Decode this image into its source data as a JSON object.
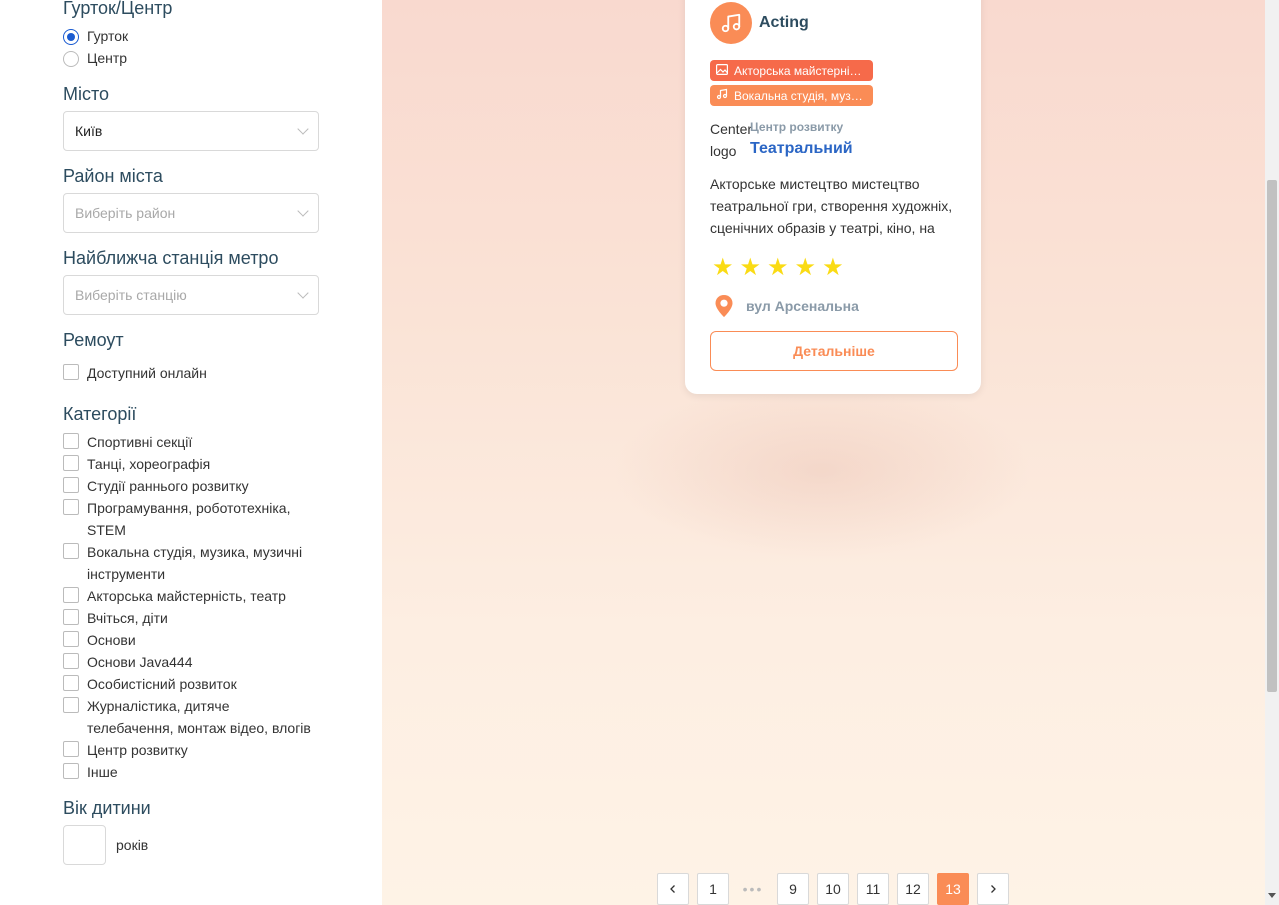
{
  "filters": {
    "type_title": "Гурток/Центр",
    "type_options": [
      {
        "label": "Гурток",
        "checked": true
      },
      {
        "label": "Центр",
        "checked": false
      }
    ],
    "city_title": "Місто",
    "city_value": "Київ",
    "district_title": "Район міста",
    "district_placeholder": "Виберіть район",
    "metro_title": "Найближча станція метро",
    "metro_placeholder": "Виберіть станцію",
    "remote_title": "Ремоут",
    "remote_label": "Доступний онлайн",
    "categories_title": "Категорії",
    "categories": [
      "Спортивні секції",
      "Танці, хореографія",
      "Студії раннього розвитку",
      "Програмування, робототехніка, STEM",
      "Вокальна студія, музика, музичні інструменти",
      "Акторська майстерність, театр",
      "Вчіться, діти",
      "Основи",
      "Основи Java444",
      "Особистісний розвиток",
      "Журналістика, дитяче телебачення, монтаж відео, влогів",
      "Центр розвитку",
      "Інше"
    ],
    "age_title": "Вік дитини",
    "age_unit": "років"
  },
  "card": {
    "category_icon": "music-note-icon",
    "category_title": "Acting",
    "tags": [
      {
        "icon": "picture-icon",
        "label": "Акторська майстерність, театр",
        "color": "#f66a4a"
      },
      {
        "icon": "music-note-icon",
        "label": "Вокальна студія, музика, музичні інструменти",
        "color": "#fa8c56"
      }
    ],
    "logo_alt": "Center logo",
    "center_type": "Центр розвитку",
    "center_name": "Театральний",
    "description": "Акторське мистецтво мистецтво театральної гри, створення художніх, сценічних образів у театрі, кіно, на телебаченні.",
    "rating": 5,
    "address": "вул Арсенальна",
    "details_button": "Детальніше"
  },
  "pagination": {
    "pages": [
      "1",
      "•••",
      "9",
      "10",
      "11",
      "12",
      "13"
    ],
    "current": "13"
  },
  "colors": {
    "accent": "#fa8c56",
    "tag_red": "#f66a4a",
    "link_blue": "#2b66c5",
    "heading": "#2d4c5f",
    "star": "#fadb14"
  }
}
